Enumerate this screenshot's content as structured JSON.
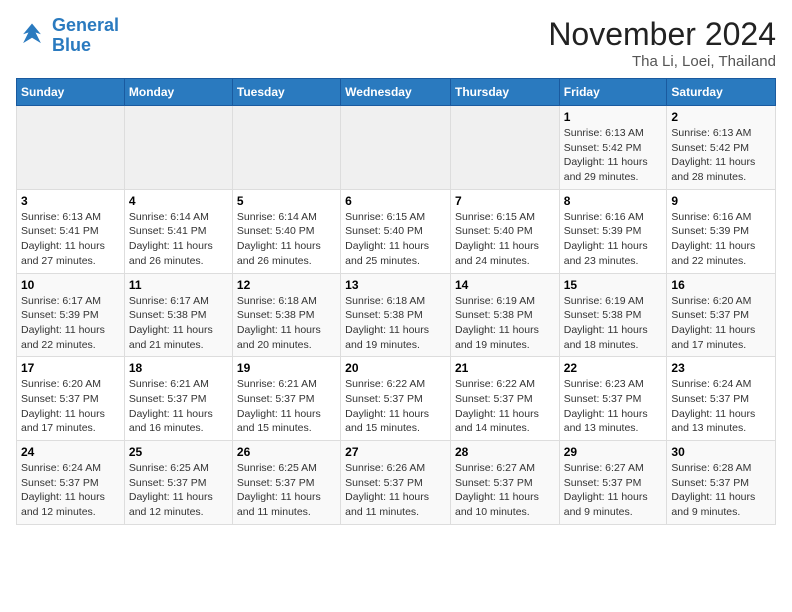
{
  "logo": {
    "line1": "General",
    "line2": "Blue"
  },
  "title": "November 2024",
  "location": "Tha Li, Loei, Thailand",
  "weekdays": [
    "Sunday",
    "Monday",
    "Tuesday",
    "Wednesday",
    "Thursday",
    "Friday",
    "Saturday"
  ],
  "weeks": [
    [
      {
        "day": "",
        "info": ""
      },
      {
        "day": "",
        "info": ""
      },
      {
        "day": "",
        "info": ""
      },
      {
        "day": "",
        "info": ""
      },
      {
        "day": "",
        "info": ""
      },
      {
        "day": "1",
        "info": "Sunrise: 6:13 AM\nSunset: 5:42 PM\nDaylight: 11 hours\nand 29 minutes."
      },
      {
        "day": "2",
        "info": "Sunrise: 6:13 AM\nSunset: 5:42 PM\nDaylight: 11 hours\nand 28 minutes."
      }
    ],
    [
      {
        "day": "3",
        "info": "Sunrise: 6:13 AM\nSunset: 5:41 PM\nDaylight: 11 hours\nand 27 minutes."
      },
      {
        "day": "4",
        "info": "Sunrise: 6:14 AM\nSunset: 5:41 PM\nDaylight: 11 hours\nand 26 minutes."
      },
      {
        "day": "5",
        "info": "Sunrise: 6:14 AM\nSunset: 5:40 PM\nDaylight: 11 hours\nand 26 minutes."
      },
      {
        "day": "6",
        "info": "Sunrise: 6:15 AM\nSunset: 5:40 PM\nDaylight: 11 hours\nand 25 minutes."
      },
      {
        "day": "7",
        "info": "Sunrise: 6:15 AM\nSunset: 5:40 PM\nDaylight: 11 hours\nand 24 minutes."
      },
      {
        "day": "8",
        "info": "Sunrise: 6:16 AM\nSunset: 5:39 PM\nDaylight: 11 hours\nand 23 minutes."
      },
      {
        "day": "9",
        "info": "Sunrise: 6:16 AM\nSunset: 5:39 PM\nDaylight: 11 hours\nand 22 minutes."
      }
    ],
    [
      {
        "day": "10",
        "info": "Sunrise: 6:17 AM\nSunset: 5:39 PM\nDaylight: 11 hours\nand 22 minutes."
      },
      {
        "day": "11",
        "info": "Sunrise: 6:17 AM\nSunset: 5:38 PM\nDaylight: 11 hours\nand 21 minutes."
      },
      {
        "day": "12",
        "info": "Sunrise: 6:18 AM\nSunset: 5:38 PM\nDaylight: 11 hours\nand 20 minutes."
      },
      {
        "day": "13",
        "info": "Sunrise: 6:18 AM\nSunset: 5:38 PM\nDaylight: 11 hours\nand 19 minutes."
      },
      {
        "day": "14",
        "info": "Sunrise: 6:19 AM\nSunset: 5:38 PM\nDaylight: 11 hours\nand 19 minutes."
      },
      {
        "day": "15",
        "info": "Sunrise: 6:19 AM\nSunset: 5:38 PM\nDaylight: 11 hours\nand 18 minutes."
      },
      {
        "day": "16",
        "info": "Sunrise: 6:20 AM\nSunset: 5:37 PM\nDaylight: 11 hours\nand 17 minutes."
      }
    ],
    [
      {
        "day": "17",
        "info": "Sunrise: 6:20 AM\nSunset: 5:37 PM\nDaylight: 11 hours\nand 17 minutes."
      },
      {
        "day": "18",
        "info": "Sunrise: 6:21 AM\nSunset: 5:37 PM\nDaylight: 11 hours\nand 16 minutes."
      },
      {
        "day": "19",
        "info": "Sunrise: 6:21 AM\nSunset: 5:37 PM\nDaylight: 11 hours\nand 15 minutes."
      },
      {
        "day": "20",
        "info": "Sunrise: 6:22 AM\nSunset: 5:37 PM\nDaylight: 11 hours\nand 15 minutes."
      },
      {
        "day": "21",
        "info": "Sunrise: 6:22 AM\nSunset: 5:37 PM\nDaylight: 11 hours\nand 14 minutes."
      },
      {
        "day": "22",
        "info": "Sunrise: 6:23 AM\nSunset: 5:37 PM\nDaylight: 11 hours\nand 13 minutes."
      },
      {
        "day": "23",
        "info": "Sunrise: 6:24 AM\nSunset: 5:37 PM\nDaylight: 11 hours\nand 13 minutes."
      }
    ],
    [
      {
        "day": "24",
        "info": "Sunrise: 6:24 AM\nSunset: 5:37 PM\nDaylight: 11 hours\nand 12 minutes."
      },
      {
        "day": "25",
        "info": "Sunrise: 6:25 AM\nSunset: 5:37 PM\nDaylight: 11 hours\nand 12 minutes."
      },
      {
        "day": "26",
        "info": "Sunrise: 6:25 AM\nSunset: 5:37 PM\nDaylight: 11 hours\nand 11 minutes."
      },
      {
        "day": "27",
        "info": "Sunrise: 6:26 AM\nSunset: 5:37 PM\nDaylight: 11 hours\nand 11 minutes."
      },
      {
        "day": "28",
        "info": "Sunrise: 6:27 AM\nSunset: 5:37 PM\nDaylight: 11 hours\nand 10 minutes."
      },
      {
        "day": "29",
        "info": "Sunrise: 6:27 AM\nSunset: 5:37 PM\nDaylight: 11 hours\nand 9 minutes."
      },
      {
        "day": "30",
        "info": "Sunrise: 6:28 AM\nSunset: 5:37 PM\nDaylight: 11 hours\nand 9 minutes."
      }
    ]
  ]
}
